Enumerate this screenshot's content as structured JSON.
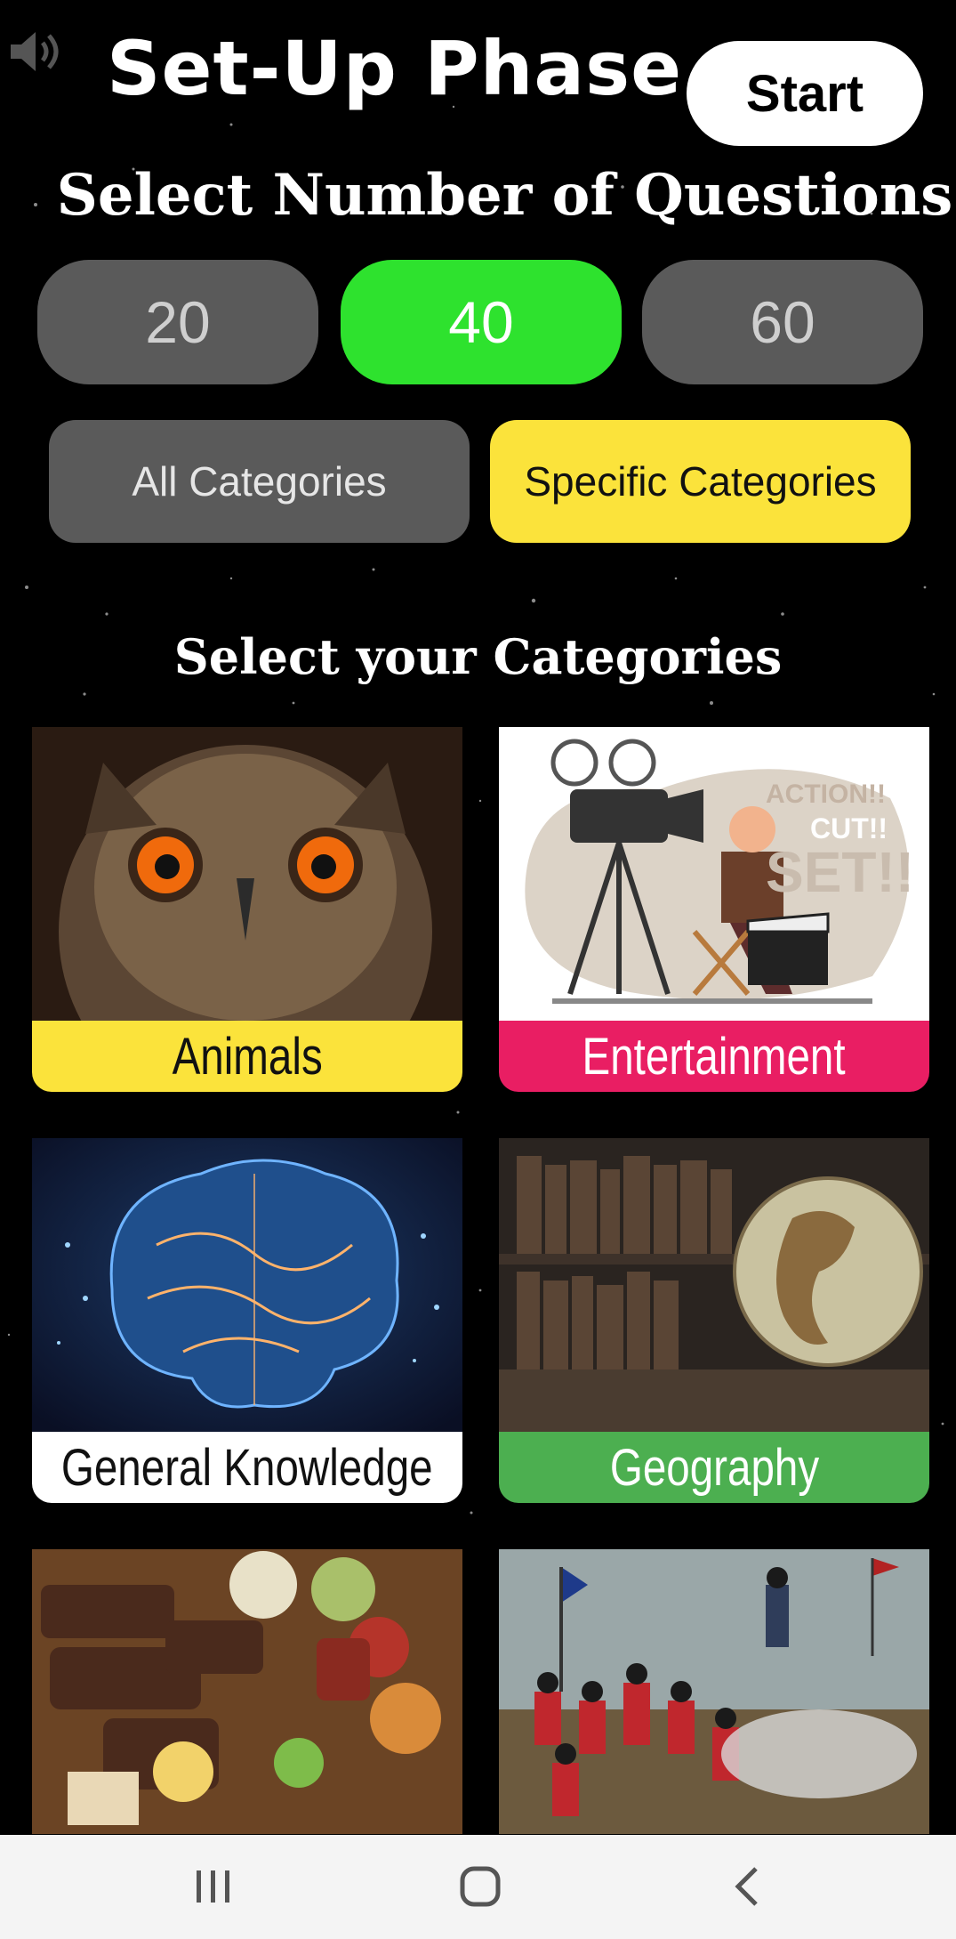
{
  "header": {
    "title": "Set-Up Phase",
    "start_label": "Start",
    "sound_icon": "speaker-icon"
  },
  "questions": {
    "heading": "Select Number of Questions",
    "options": [
      {
        "label": "20",
        "selected": false
      },
      {
        "label": "40",
        "selected": true
      },
      {
        "label": "60",
        "selected": false
      }
    ],
    "selected_color": "#2EE22E"
  },
  "modes": {
    "all_label": "All Categories",
    "specific_label": "Specific Categories",
    "selected": "Specific Categories",
    "selected_color": "#FBE33B"
  },
  "categories": {
    "heading": "Select your Categories",
    "items": [
      {
        "label": "Animals",
        "color": "#FBE33B",
        "image": "owl-photo"
      },
      {
        "label": "Entertainment",
        "color": "#E91E63",
        "image": "film-director-illustration"
      },
      {
        "label": "General Knowledge",
        "color": "#FFFFFF",
        "image": "glowing-brain-photo"
      },
      {
        "label": "Geography",
        "color": "#4CAF50",
        "image": "globe-bookshelf-photo"
      },
      {
        "label": "",
        "image": "bbq-platter-photo"
      },
      {
        "label": "",
        "image": "battle-painting"
      }
    ]
  },
  "system_nav": {
    "icons": [
      "recent-apps-icon",
      "home-icon",
      "back-icon"
    ]
  }
}
